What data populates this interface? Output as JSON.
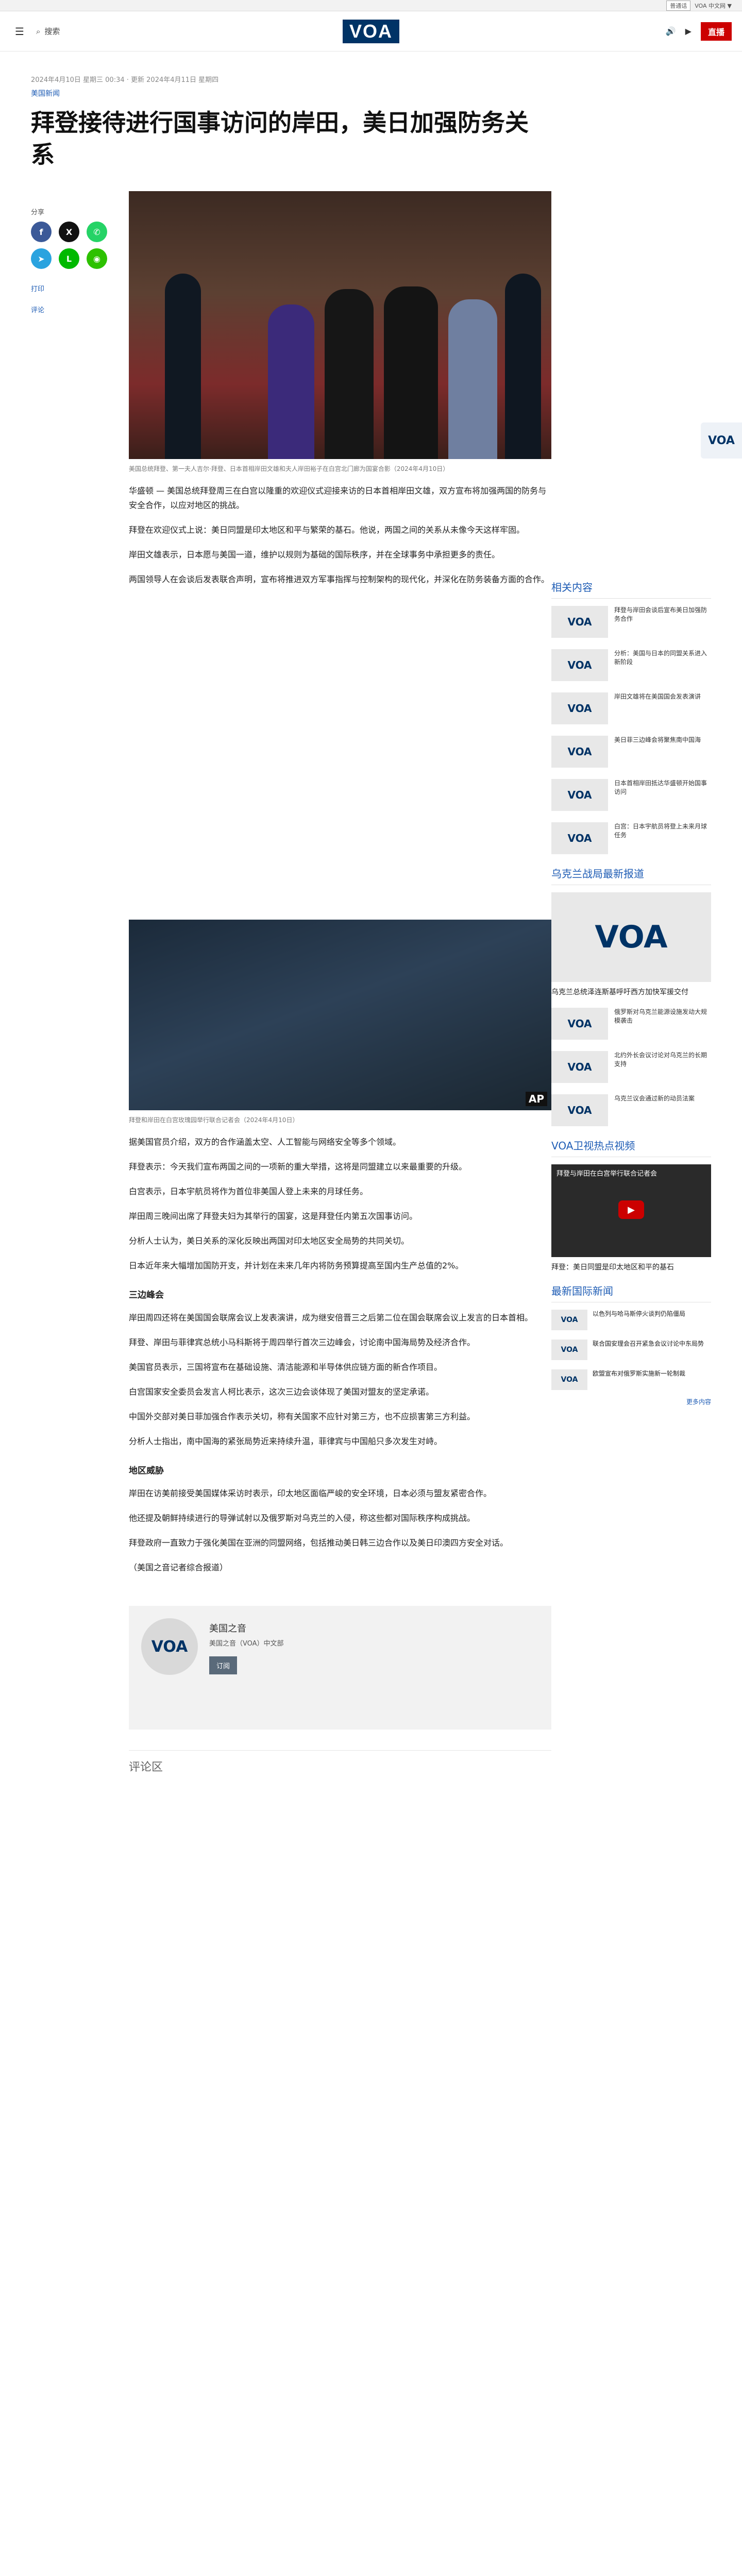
{
  "util": {
    "language": "普通话",
    "lang_options": "VOA 中文网 ▼"
  },
  "header": {
    "menu_icon": "menu-icon",
    "search_label": "搜索",
    "logo": "VOA",
    "live": "直播",
    "audio": "🔊",
    "video": "▶"
  },
  "article": {
    "dateline": "2024年4月10日 星期三 00:34 · 更新 2024年4月11日 星期四",
    "category": "美国新闻",
    "title": "拜登接待进行国事访问的岸田，美日加强防务关系",
    "caption": "美国总统拜登、第一夫人吉尔·拜登、日本首相岸田文雄和夫人岸田裕子在白宫北门廊为国宴合影（2024年4月10日）",
    "paragraphs": [
      "华盛顿 — 美国总统拜登周三在白宫以隆重的欢迎仪式迎接来访的日本首相岸田文雄，双方宣布将加强两国的防务与安全合作，以应对地区的挑战。",
      "拜登在欢迎仪式上说：美日同盟是印太地区和平与繁荣的基石。他说，两国之间的关系从未像今天这样牢固。",
      "岸田文雄表示，日本愿与美国一道，维护以规则为基础的国际秩序，并在全球事务中承担更多的责任。",
      "两国领导人在会谈后发表联合声明，宣布将推进双方军事指挥与控制架构的现代化，并深化在防务装备方面的合作。"
    ],
    "mid_paragraphs": [
      "据美国官员介绍，双方的合作涵盖太空、人工智能与网络安全等多个领域。",
      "拜登表示：今天我们宣布两国之间的一项新的重大举措，这将是同盟建立以来最重要的升级。",
      "白宫表示，日本宇航员将作为首位非美国人登上未来的月球任务。",
      "岸田周三晚间出席了拜登夫妇为其举行的国宴，这是拜登任内第五次国事访问。",
      "分析人士认为，美日关系的深化反映出两国对印太地区安全局势的共同关切。",
      "日本近年来大幅增加国防开支，并计划在未来几年内将防务预算提高至国内生产总值的2%。"
    ],
    "subhead_1": "三边峰会",
    "late_paragraphs": [
      "岸田周四还将在美国国会联席会议上发表演讲，成为继安倍晋三之后第二位在国会联席会议上发言的日本首相。",
      "拜登、岸田与菲律宾总统小马科斯将于周四举行首次三边峰会，讨论南中国海局势及经济合作。",
      "美国官员表示，三国将宣布在基础设施、清洁能源和半导体供应链方面的新合作项目。",
      "白宫国家安全委员会发言人柯比表示，这次三边会谈体现了美国对盟友的坚定承诺。",
      "中国外交部对美日菲加强合作表示关切，称有关国家不应针对第三方，也不应损害第三方利益。",
      "分析人士指出，南中国海的紧张局势近来持续升温，菲律宾与中国船只多次发生对峙。"
    ],
    "subhead_2": "地区威胁",
    "end_paragraphs": [
      "岸田在访美前接受美国媒体采访时表示，印太地区面临严峻的安全环境，日本必须与盟友紧密合作。",
      "他还提及朝鲜持续进行的导弹试射以及俄罗斯对乌克兰的入侵，称这些都对国际秩序构成挑战。",
      "拜登政府一直致力于强化美国在亚洲的同盟网络，包括推动美日韩三边合作以及美日印澳四方安全对话。",
      "（美国之音记者综合报道）"
    ],
    "vid_caption": "拜登和岸田在白宫玫瑰园举行联合记者会（2024年4月10日）"
  },
  "share": {
    "label": "分享",
    "buttons": [
      {
        "name": "facebook-share-button",
        "icon": "f",
        "color": "#3b5998"
      },
      {
        "name": "x-share-button",
        "icon": "X",
        "color": "#111111"
      },
      {
        "name": "whatsapp-share-button",
        "icon": "✆",
        "color": "#25d366"
      },
      {
        "name": "telegram-share-button",
        "icon": "➤",
        "color": "#2aa3df"
      },
      {
        "name": "line-share-button",
        "icon": "L",
        "color": "#00b900"
      },
      {
        "name": "wechat-share-button",
        "icon": "◉",
        "color": "#2dc100"
      }
    ],
    "print": "打印",
    "comment": "评论"
  },
  "sidebar": {
    "related_title": "相关内容",
    "related": [
      "拜登与岸田会谈后宣布美日加强防务合作",
      "分析：美国与日本的同盟关系进入新阶段",
      "岸田文雄将在美国国会发表演讲",
      "美日菲三边峰会将聚焦南中国海",
      "日本首相岸田抵达华盛顿开始国事访问",
      "白宫：日本宇航员将登上未来月球任务"
    ],
    "featured_title": "乌克兰战局最新报道",
    "featured_caption": "乌克兰总统泽连斯基呼吁西方加快军援交付",
    "featured_list": [
      "俄罗斯对乌克兰能源设施发动大规模袭击",
      "北约外长会议讨论对乌克兰的长期支持",
      "乌克兰议会通过新的动员法案"
    ],
    "video_title": "VOA卫视热点视频",
    "video_headline": "拜登与岸田在白宫举行联合记者会",
    "video_caption": "拜登：美日同盟是印太地区和平的基石",
    "news_title": "最新国际新闻",
    "news": [
      "以色列与哈马斯停火谈判仍陷僵局",
      "联合国安理会召开紧急会议讨论中东局势",
      "欧盟宣布对俄罗斯实施新一轮制裁"
    ],
    "more": "更多内容"
  },
  "author": {
    "initials": "VOA",
    "name": "美国之音",
    "desc": "美国之音（VOA）中文部",
    "button": "订阅"
  },
  "comments": {
    "title": "评论区"
  }
}
